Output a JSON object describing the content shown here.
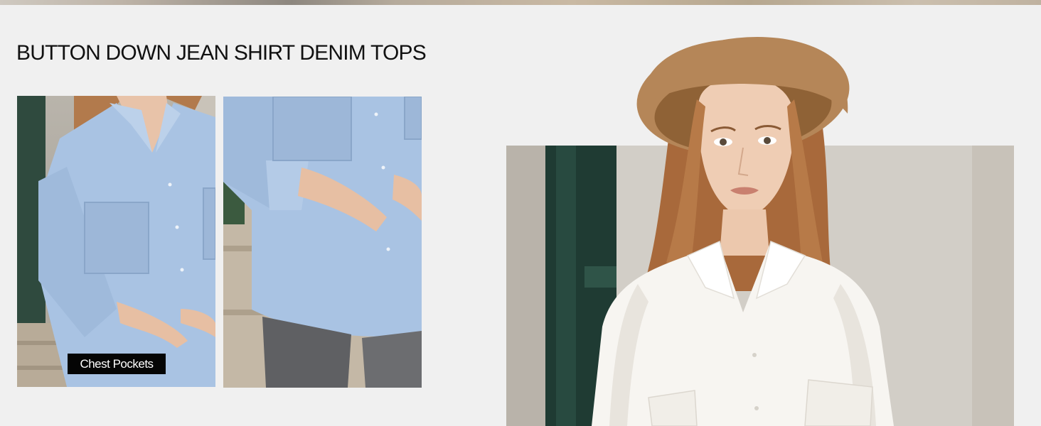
{
  "section": {
    "title": "BUTTON DOWN JEAN SHIRT DENIM TOPS"
  },
  "detail_photos": [
    {
      "caption": "Chest Pockets"
    },
    {
      "caption": ""
    }
  ],
  "colors": {
    "background": "#f0f0f0",
    "denim_shirt": "#a9c3e3",
    "white_shirt": "#f7f5f1",
    "hat": "#b58658",
    "caption_bg": "#050505",
    "caption_text": "#ffffff"
  }
}
